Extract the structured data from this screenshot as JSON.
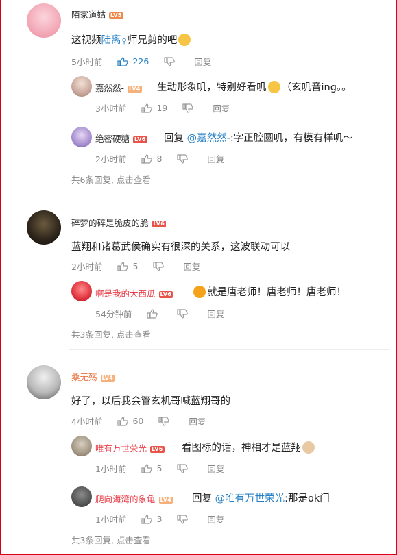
{
  "threads": [
    {
      "user": "陌家道姑",
      "level": "LV5",
      "text_before": "这视频",
      "link": "陆离",
      "text_after": "师兄剪的吧",
      "time": "5小时前",
      "likes": "226",
      "reply_label": "回复",
      "replies": [
        {
          "user": "嘉然然-",
          "level": "LV4",
          "text": "生动形象叽，特别好看叽",
          "text_tail": "（玄叽音ing。。",
          "time": "3小时前",
          "likes": "19",
          "reply_label": "回复"
        },
        {
          "user": "绝密硬糖",
          "level": "LV6",
          "reply_word": "回复",
          "mention": "@嘉然然-",
          "text": ":字正腔圆叽，有模有样叽～",
          "time": "2小时前",
          "likes": "8",
          "reply_label": "回复"
        }
      ],
      "more": "共6条回复, 点击查看"
    },
    {
      "user": "碎梦的碎是脆皮的脆",
      "level": "LV6",
      "text": "蓝翔和诸葛武侯确实有很深的关系，这波联动可以",
      "time": "2小时前",
      "likes": "5",
      "reply_label": "回复",
      "replies": [
        {
          "user": "啊是我的大西瓜",
          "level": "LV6",
          "text": "就是唐老师！唐老师！唐老师！",
          "time": "54分钟前",
          "reply_label": "回复"
        }
      ],
      "more": "共3条回复, 点击查看"
    },
    {
      "user": "桑无殇",
      "level": "LV4",
      "text": "好了，以后我会管玄机哥喊蓝翔哥的",
      "time": "4小时前",
      "likes": "60",
      "reply_label": "回复",
      "replies": [
        {
          "user": "唯有万世荣光",
          "level": "LV6",
          "text": "看图标的话，神相才是蓝翔",
          "time": "1小时前",
          "likes": "5",
          "reply_label": "回复"
        },
        {
          "user": "爬向海湾的象龟",
          "level": "LV4",
          "reply_word": "回复",
          "mention": "@唯有万世荣光",
          "text": ":那是ok门",
          "time": "1小时前",
          "likes": "3",
          "reply_label": "回复"
        }
      ],
      "more": "共3条回复, 点击查看"
    }
  ],
  "colors": {
    "accent": "#2680c6",
    "frame": "#d9001b",
    "username_pink": "#eb7340",
    "username_red": "#e8404a"
  },
  "icons": [
    "like-icon",
    "dislike-icon",
    "search-icon"
  ]
}
